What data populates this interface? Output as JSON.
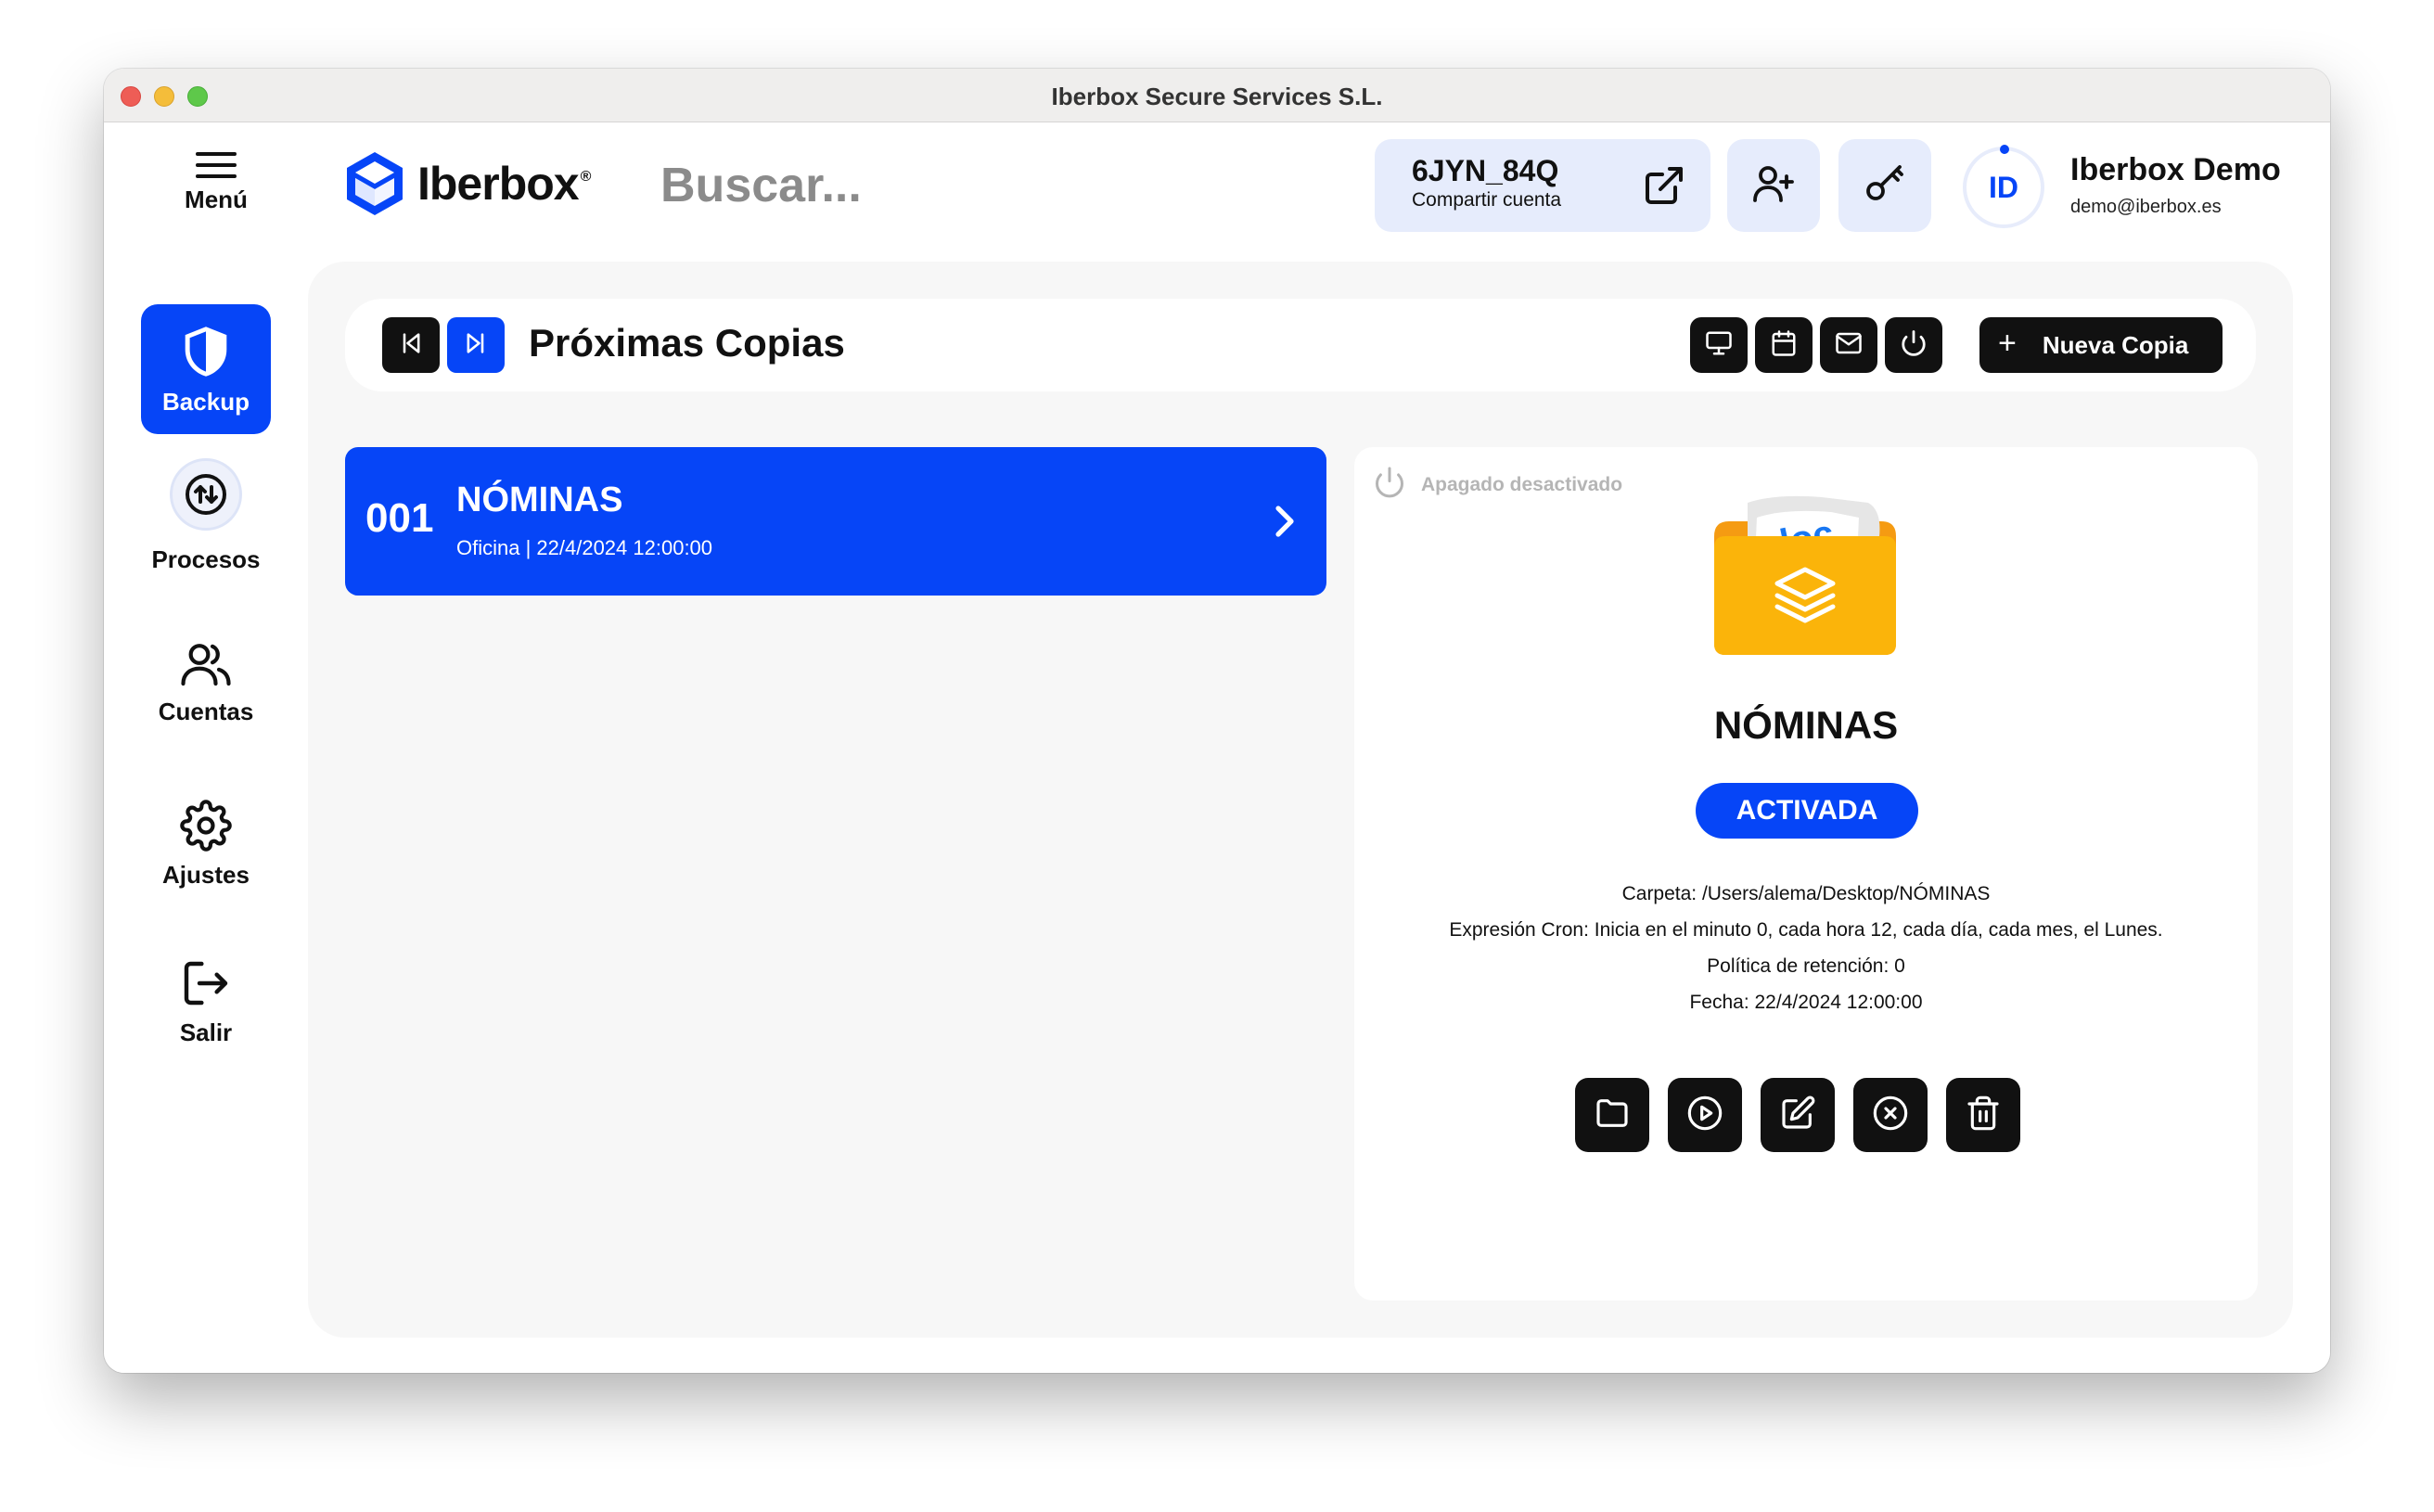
{
  "window": {
    "title": "Iberbox Secure Services S.L."
  },
  "sidebar": {
    "menu_label": "Menú",
    "items": [
      {
        "label": "Backup",
        "icon": "shield-icon",
        "active": true
      },
      {
        "label": "Procesos",
        "icon": "sync-icon"
      },
      {
        "label": "Cuentas",
        "icon": "users-icon"
      },
      {
        "label": "Ajustes",
        "icon": "gear-icon"
      },
      {
        "label": "Salir",
        "icon": "logout-icon"
      }
    ]
  },
  "header": {
    "logo_text": "Iberbox",
    "logo_reg": "®",
    "search_placeholder": "Buscar...",
    "account_code": "6JYN_84Q",
    "share_label": "Compartir cuenta",
    "user_initials": "ID",
    "user_name": "Iberbox Demo",
    "user_email": "demo@iberbox.es"
  },
  "toolbar": {
    "title": "Próximas Copias",
    "new_copy_label": "Nueva Copia",
    "icons": [
      "monitor-icon",
      "calendar-icon",
      "mail-icon",
      "power-icon"
    ]
  },
  "list": [
    {
      "number": "001",
      "name": "NÓMINAS",
      "subtitle": "Oficina | 22/4/2024 12:00:00"
    }
  ],
  "detail": {
    "power_status": "Apagado desactivado",
    "folder_tag": "doc",
    "name": "NÓMINAS",
    "status": "ACTIVADA",
    "folder_line": "Carpeta: /Users/alema/Desktop/NÓMINAS",
    "cron_line": "Expresión Cron: Inicia en el minuto 0, cada hora 12, cada día, cada mes, el Lunes.",
    "retention_line": "Política de retención: 0",
    "date_line": "Fecha: 22/4/2024 12:00:00",
    "actions": [
      "folder-icon",
      "play-icon",
      "edit-icon",
      "cancel-icon",
      "trash-icon"
    ]
  },
  "colors": {
    "accent": "#0645f7",
    "dark": "#111111",
    "folder": "#f9a81b",
    "panel": "#f7f7f7"
  }
}
